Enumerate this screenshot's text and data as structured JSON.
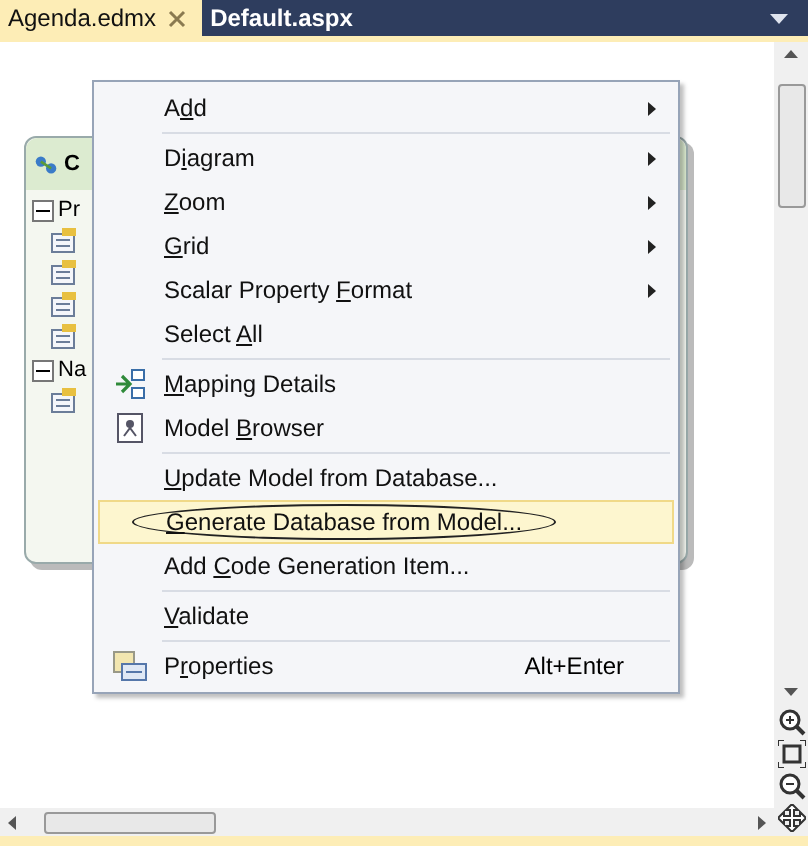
{
  "tabs": [
    {
      "label": "Agenda.edmx",
      "selected": true,
      "closable": true
    },
    {
      "label": "Default.aspx",
      "selected": false,
      "closable": false
    }
  ],
  "entity": {
    "title": "C",
    "sections": [
      {
        "label": "Pr",
        "expanded": true
      },
      {
        "label": "Na",
        "expanded": true
      }
    ]
  },
  "menu": [
    {
      "kind": "submenu",
      "selected": false,
      "parts": {
        "before": "A",
        "key": "d",
        "after": "d"
      }
    },
    {
      "kind": "separator"
    },
    {
      "kind": "submenu",
      "selected": false,
      "parts": {
        "before": "D",
        "key": "i",
        "after": "agram"
      }
    },
    {
      "kind": "submenu",
      "selected": false,
      "parts": {
        "key": "Z",
        "after": "oom"
      }
    },
    {
      "kind": "submenu",
      "selected": false,
      "parts": {
        "key": "G",
        "after": "rid"
      }
    },
    {
      "kind": "submenu",
      "selected": false,
      "parts": {
        "before": "Scalar Property ",
        "key": "F",
        "after": "ormat"
      }
    },
    {
      "kind": "command",
      "selected": false,
      "parts": {
        "before": "Select ",
        "key": "A",
        "after": "ll"
      }
    },
    {
      "kind": "separator"
    },
    {
      "kind": "command",
      "selected": false,
      "parts": {
        "key": "M",
        "after": "apping Details"
      }
    },
    {
      "kind": "command",
      "selected": false,
      "parts": {
        "before": "Model ",
        "key": "B",
        "after": "rowser"
      }
    },
    {
      "kind": "separator"
    },
    {
      "kind": "command",
      "selected": false,
      "parts": {
        "key": "U",
        "after": "pdate Model from Database..."
      }
    },
    {
      "kind": "command",
      "selected": true,
      "circled": true,
      "parts": {
        "key": "G",
        "after": "enerate Database from Model..."
      }
    },
    {
      "kind": "command",
      "selected": false,
      "parts": {
        "before": "Add ",
        "key": "C",
        "after": "ode Generation Item..."
      }
    },
    {
      "kind": "separator"
    },
    {
      "kind": "command",
      "selected": false,
      "parts": {
        "key": "V",
        "after": "alidate"
      }
    },
    {
      "kind": "separator"
    },
    {
      "kind": "command",
      "selected": false,
      "shortcut": "Alt+Enter",
      "parts": {
        "before": "P",
        "key": "r",
        "after": "operties"
      }
    }
  ]
}
